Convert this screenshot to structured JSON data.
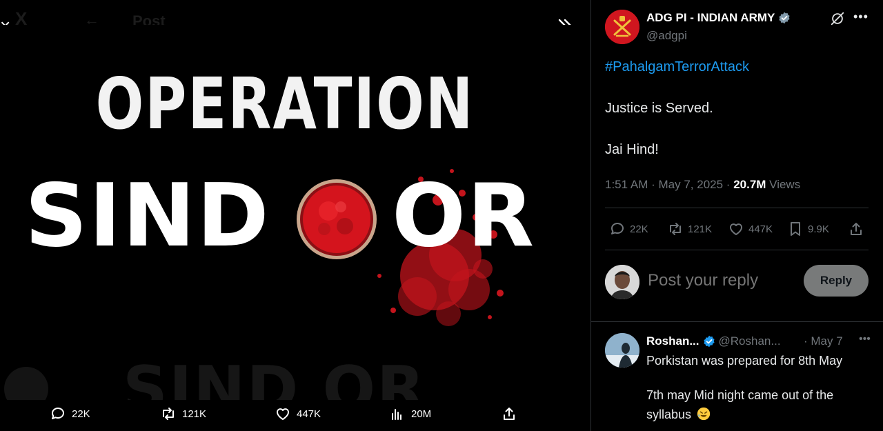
{
  "viewer": {
    "ghost_header_title": "Post",
    "poster": {
      "title_top": "OPERATION",
      "title_main_left": "SIND",
      "title_main_right": "OR",
      "ghost_bottom_text": "SIND  OR"
    },
    "actions": {
      "replies": "22K",
      "reposts": "121K",
      "likes": "447K",
      "views": "20M"
    }
  },
  "post": {
    "author_name": "ADG PI - INDIAN ARMY",
    "author_handle": "@adgpi",
    "hashtag": "#PahalgamTerrorAttack",
    "body_line1": "Justice is Served.",
    "body_line2": "Jai Hind!",
    "time": "1:51 AM",
    "date": "May 7, 2025",
    "views_count": "20.7M",
    "views_label": "Views",
    "actions": {
      "replies": "22K",
      "reposts": "121K",
      "likes": "447K",
      "bookmarks": "9.9K"
    }
  },
  "composer": {
    "placeholder": "Post your reply",
    "button_label": "Reply"
  },
  "reply": {
    "name": "Roshan...",
    "handle": "@Roshan...",
    "date": "May 7",
    "line1": "Porkistan was prepared for 8th May",
    "line2": "7th may Mid night came out of the",
    "line3": "syllabus"
  },
  "colors": {
    "accent": "#1d9bf0",
    "muted": "#71767b",
    "sindoor_red": "#d4141d",
    "reply_button_bg": "#787a7a"
  },
  "icons": {
    "close": "close-icon",
    "expand": "double-chevron-right-icon",
    "reply": "speech-bubble-icon",
    "repost": "repost-icon",
    "like": "heart-icon",
    "views": "bar-chart-icon",
    "bookmark": "bookmark-icon",
    "share": "share-icon",
    "grok": "grok-icon",
    "more": "more-dots-icon",
    "verified": "verified-badge-icon"
  }
}
